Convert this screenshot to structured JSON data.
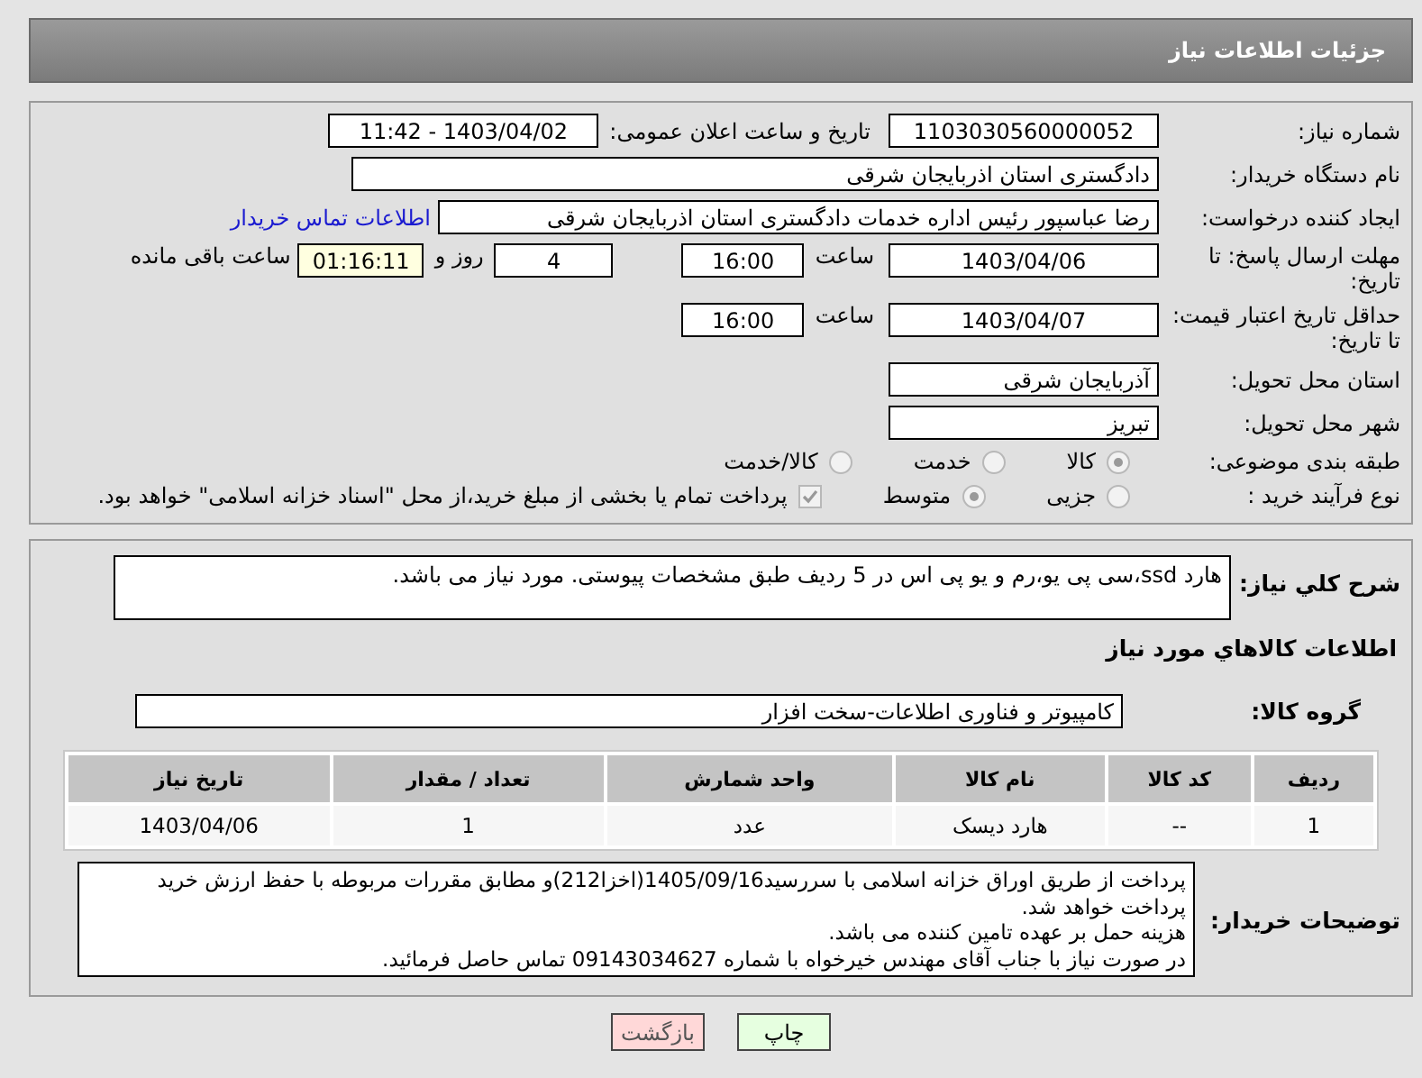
{
  "header": {
    "title": "جزئیات اطلاعات نیاز"
  },
  "form": {
    "need_number": {
      "label": "شماره نیاز:",
      "value": "1103030560000052"
    },
    "announce": {
      "label": "تاریخ و ساعت اعلان عمومی:",
      "value": "1403/04/02 - 11:42"
    },
    "buyer_org": {
      "label": "نام دستگاه خریدار:",
      "value": "دادگستری استان اذربایجان شرقی"
    },
    "requester": {
      "label": "ایجاد کننده درخواست:",
      "value": "رضا عباسپور رئیس اداره خدمات دادگستری استان اذربایجان شرقی",
      "link": "اطلاعات تماس خریدار"
    },
    "deadline": {
      "label": "مهلت ارسال پاسخ: تا تاریخ:",
      "date": "1403/04/06",
      "time_label": "ساعت",
      "time": "16:00",
      "days": "4",
      "days_label": "روز و",
      "remaining": "01:16:11",
      "remaining_label": "ساعت باقی مانده"
    },
    "validity": {
      "label": "حداقل تاریخ اعتبار قیمت: تا تاریخ:",
      "date": "1403/04/07",
      "time_label": "ساعت",
      "time": "16:00"
    },
    "province": {
      "label": "استان محل تحویل:",
      "value": "آذربایجان شرقی"
    },
    "city": {
      "label": "شهر محل تحویل:",
      "value": "تبریز"
    },
    "category": {
      "label": "طبقه بندی موضوعی:",
      "options": [
        {
          "label": "کالا",
          "selected": true
        },
        {
          "label": "خدمت",
          "selected": false
        },
        {
          "label": "کالا/خدمت",
          "selected": false
        }
      ]
    },
    "process": {
      "label": "نوع فرآیند خرید :",
      "options": [
        {
          "label": "جزیی",
          "selected": false
        },
        {
          "label": "متوسط",
          "selected": true
        }
      ],
      "treasury": {
        "label": "پرداخت تمام یا بخشی از مبلغ خرید،از محل \"اسناد خزانه اسلامی\" خواهد بود.",
        "checked": true
      }
    }
  },
  "goods": {
    "description": {
      "label": "شرح کلي نياز:",
      "value": "هارد ssd،سی پی یو،رم و یو پی اس در 5 ردیف طبق مشخصات پیوستی.  مورد نیاز می باشد."
    },
    "section_title": "اطلاعات کالاهاي مورد نياز",
    "group": {
      "label": "گروه کالا:",
      "value": "کامپیوتر و فناوری اطلاعات-سخت افزار"
    },
    "table": {
      "columns": [
        "ردیف",
        "کد کالا",
        "نام کالا",
        "واحد شمارش",
        "تعداد / مقدار",
        "تاریخ نیاز"
      ],
      "rows": [
        [
          "1",
          "--",
          "هارد دیسک",
          "عدد",
          "1",
          "1403/04/06"
        ]
      ]
    },
    "notes": {
      "label": "توضیحات خریدار:",
      "lines": [
        "پرداخت از طریق اوراق خزانه اسلامی با سررسید1405/09/16(اخزا212)و مطابق مقررات مربوطه با حفظ ارزش خرید پرداخت خواهد شد.",
        "هزینه حمل بر عهده تامین کننده می باشد.",
        "در صورت نیاز با جناب آقای مهندس خیرخواه با شماره 09143034627 تماس حاصل فرمائید."
      ]
    }
  },
  "actions": [
    {
      "label": "چاپ",
      "kind": "print"
    },
    {
      "label": "بازگشت",
      "kind": "back"
    }
  ]
}
